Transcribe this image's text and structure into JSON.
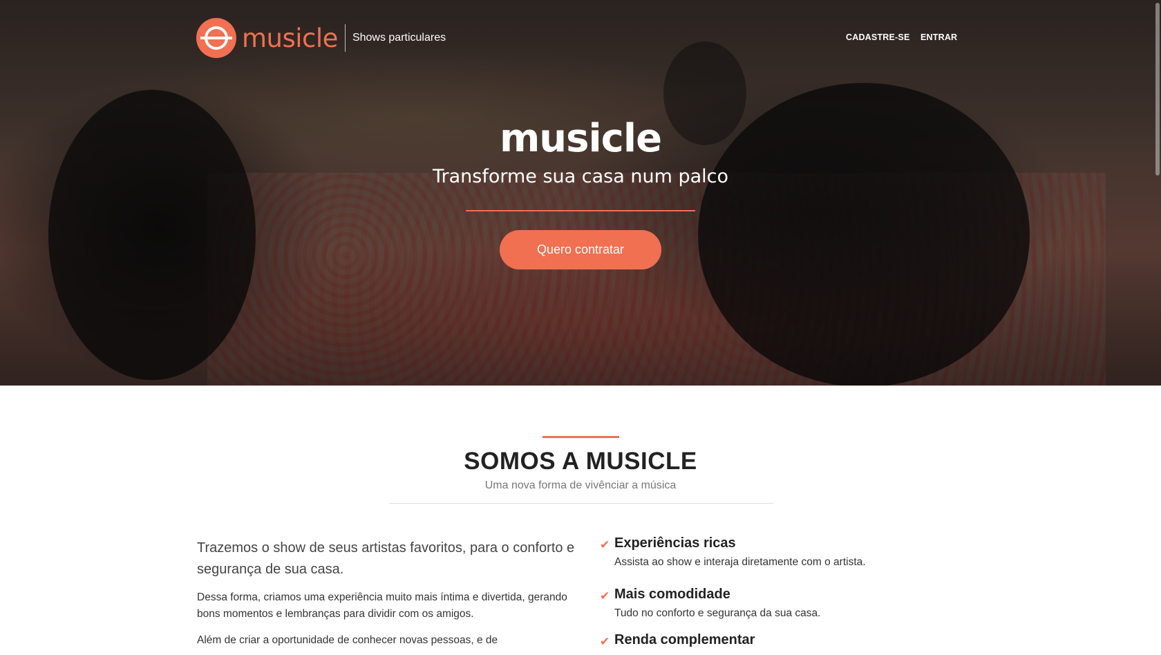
{
  "header": {
    "logo_text": "musicle",
    "tagline": "Shows particulares",
    "nav": [
      {
        "label": "CADASTRE-SE"
      },
      {
        "label": "ENTRAR"
      }
    ]
  },
  "hero": {
    "title": "musicle",
    "subtitle": "Transforme sua casa num palco",
    "cta_label": "Quero contratar"
  },
  "about": {
    "title": "SOMOS A MUSICLE",
    "subtitle": "Uma nova forma de vivênciar a música",
    "lead": "Trazemos o show de seus artistas favoritos, para o conforto e segurança de sua casa.",
    "paragraphs": [
      "Dessa forma, criamos uma experiência muito mais íntima e divertida, gerando bons momentos e lembranças para dividir com os amigos.",
      "Além de criar a oportunidade de conhecer novas pessoas, e de"
    ],
    "features": [
      {
        "title": "Experiências ricas",
        "desc": "Assista ao show e interaja diretamente com o artista."
      },
      {
        "title": "Mais comodidade",
        "desc": "Tudo no conforto e segurança da sua casa."
      },
      {
        "title": "Renda complementar",
        "desc": ""
      }
    ]
  },
  "colors": {
    "accent": "#f07051",
    "heading": "#222222",
    "muted": "#777777"
  },
  "icons": {
    "logo": "musicle-logo-icon",
    "feature_bullet": "check-icon"
  }
}
